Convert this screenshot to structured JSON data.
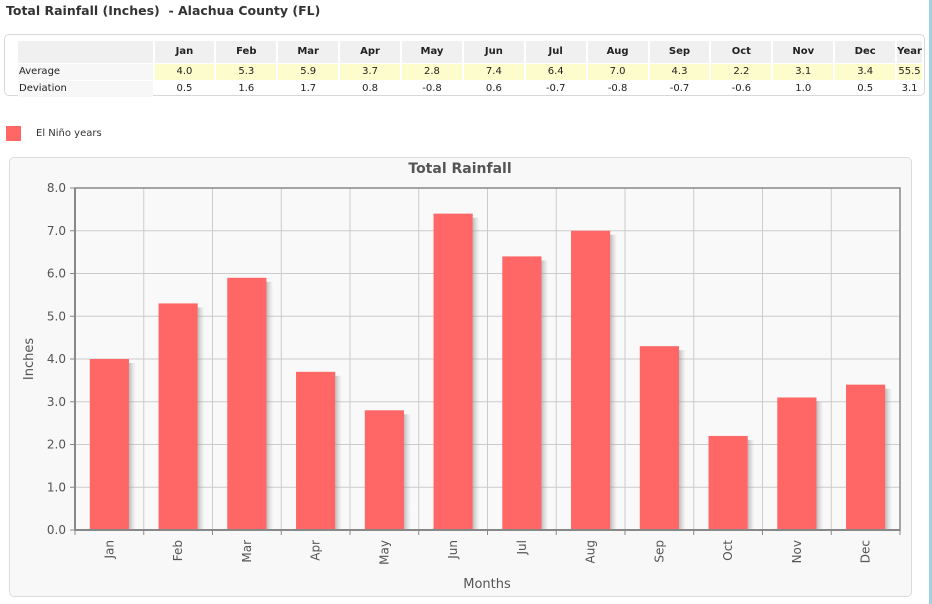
{
  "page": {
    "title": "Total Rainfall (Inches)  - Alachua County (FL)"
  },
  "table": {
    "columns": [
      "Jan",
      "Feb",
      "Mar",
      "Apr",
      "May",
      "Jun",
      "Jul",
      "Aug",
      "Sep",
      "Oct",
      "Nov",
      "Dec",
      "Year"
    ],
    "rows": [
      {
        "label": "Average",
        "values": [
          "4.0",
          "5.3",
          "5.9",
          "3.7",
          "2.8",
          "7.4",
          "6.4",
          "7.0",
          "4.3",
          "2.2",
          "3.1",
          "3.4",
          "55.5"
        ]
      },
      {
        "label": "Deviation",
        "values": [
          "0.5",
          "1.6",
          "1.7",
          "0.8",
          "-0.8",
          "0.6",
          "-0.7",
          "-0.8",
          "-0.7",
          "-0.6",
          "1.0",
          "0.5",
          "3.1"
        ]
      }
    ]
  },
  "legend": {
    "label": "El Niño years",
    "color": "#ff6666"
  },
  "chart_data": {
    "type": "bar",
    "title": "Total Rainfall",
    "xlabel": "Months",
    "ylabel": "Inches",
    "categories": [
      "Jan",
      "Feb",
      "Mar",
      "Apr",
      "May",
      "Jun",
      "Jul",
      "Aug",
      "Sep",
      "Oct",
      "Nov",
      "Dec"
    ],
    "series": [
      {
        "name": "El Niño years",
        "color": "#ff6666",
        "values": [
          4.0,
          5.3,
          5.9,
          3.7,
          2.8,
          7.4,
          6.4,
          7.0,
          4.3,
          2.2,
          3.1,
          3.4
        ]
      }
    ],
    "ylim": [
      0,
      8
    ],
    "yticks": [
      "0.0",
      "1.0",
      "2.0",
      "3.0",
      "4.0",
      "5.0",
      "6.0",
      "7.0",
      "8.0"
    ],
    "grid": true,
    "legend_position": "top-left"
  }
}
